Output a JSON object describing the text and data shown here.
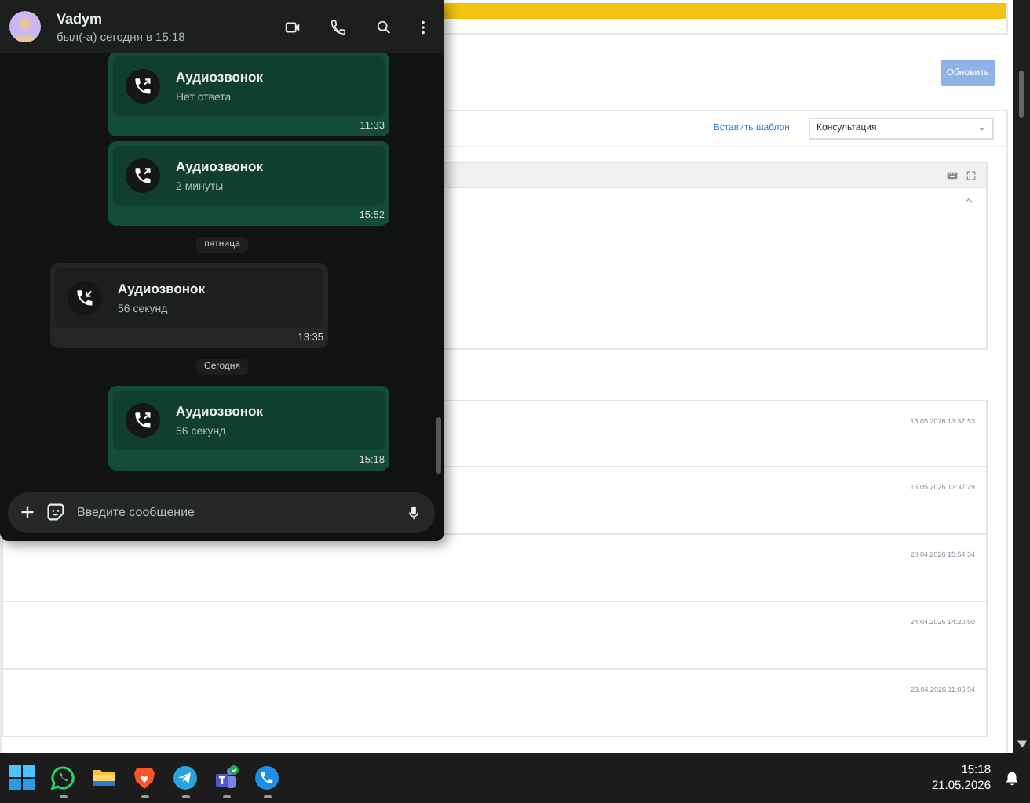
{
  "web_page": {
    "update_button": "Обновить",
    "template_link": "Вставить шаблон",
    "template_select": {
      "value": "Консультация"
    },
    "history_rows": [
      {
        "date": "15.05.2026 13:37:53"
      },
      {
        "date": "15.05.2026 13:37:29"
      },
      {
        "date": "28.04.2026 15:54:34"
      },
      {
        "date": "24.04.2026 14:20:50"
      },
      {
        "date": "23.04.2026 11:05:54"
      }
    ]
  },
  "chat": {
    "contact": {
      "name": "Vadym",
      "status": "был(-а) сегодня в 15:18"
    },
    "messages": [
      {
        "kind": "call",
        "outgoing": true,
        "title": "Аудиозвонок",
        "detail": "Нет ответа",
        "time": "11:33"
      },
      {
        "kind": "call",
        "outgoing": true,
        "title": "Аудиозвонок",
        "detail": "2 минуты",
        "time": "15:52"
      },
      {
        "kind": "date",
        "label": "пятница"
      },
      {
        "kind": "call",
        "outgoing": false,
        "title": "Аудиозвонок",
        "detail": "56 секунд",
        "time": "13:35"
      },
      {
        "kind": "date",
        "label": "Сегодня"
      },
      {
        "kind": "call",
        "outgoing": true,
        "title": "Аудиозвонок",
        "detail": "56 секунд",
        "time": "15:18"
      }
    ],
    "composer": {
      "placeholder": "Введите сообщение"
    }
  },
  "taskbar": {
    "apps": [
      {
        "kind": "start",
        "running": false
      },
      {
        "kind": "whatsapp",
        "running": true
      },
      {
        "kind": "folder",
        "running": false
      },
      {
        "kind": "brave",
        "running": true
      },
      {
        "kind": "telegram",
        "running": true
      },
      {
        "kind": "teams",
        "running": true
      },
      {
        "kind": "phone",
        "running": true
      }
    ],
    "clock": {
      "time": "15:18",
      "date": "21.05.2026"
    }
  }
}
